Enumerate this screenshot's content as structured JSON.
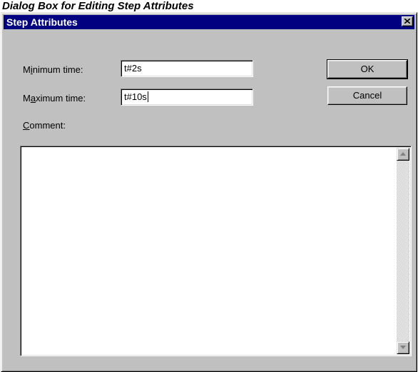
{
  "caption": "Dialog Box for Editing Step Attributes",
  "window": {
    "title": "Step Attributes",
    "close_icon": "close-x"
  },
  "form": {
    "min_time": {
      "label_pre": "M",
      "label_accel": "i",
      "label_post": "nimum time:",
      "value": "t#2s"
    },
    "max_time": {
      "label_pre": "M",
      "label_accel": "a",
      "label_post": "ximum time:",
      "value": "t#10s"
    },
    "comment": {
      "label_pre": "",
      "label_accel": "C",
      "label_post": "omment:",
      "value": ""
    }
  },
  "buttons": {
    "ok": "OK",
    "cancel": "Cancel"
  },
  "scrollbar": {
    "up_icon": "triangle-up",
    "down_icon": "triangle-down"
  },
  "colors": {
    "titlebar": "#000080",
    "face": "#c0c0c0"
  }
}
